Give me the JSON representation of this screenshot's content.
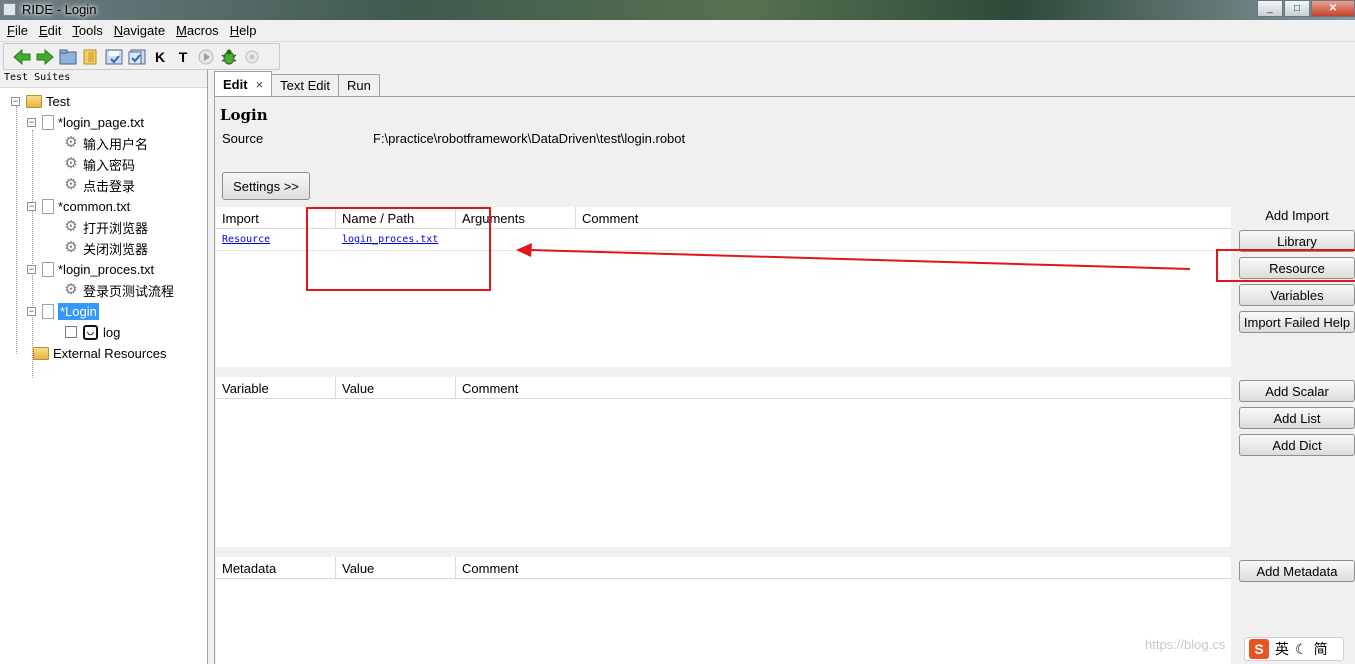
{
  "window": {
    "title": "RIDE - Login",
    "minimize": "_",
    "maximize": "□",
    "close": "✕"
  },
  "menu": [
    {
      "key": "F",
      "rest": "ile"
    },
    {
      "key": "E",
      "rest": "dit"
    },
    {
      "key": "T",
      "rest": "ools"
    },
    {
      "key": "N",
      "rest": "avigate"
    },
    {
      "key": "M",
      "rest": "acros"
    },
    {
      "key": "H",
      "rest": "elp"
    }
  ],
  "toolbar": {
    "icons": [
      "back-icon",
      "forward-icon",
      "open-folder-icon",
      "open-directory-icon",
      "save-icon",
      "save-all-icon",
      "search-keywords-icon",
      "search-tests-icon",
      "run-icon",
      "debug-bug-icon",
      "stop-icon"
    ],
    "k_label": "K",
    "t_label": "T"
  },
  "tree": {
    "header": "Test Suites",
    "nodes": {
      "test": "Test",
      "login_page": "*login_page.txt",
      "kw_input_user": "输入用户名",
      "kw_input_pwd": "输入密码",
      "kw_click_login": "点击登录",
      "common": "*common.txt",
      "kw_open_browser": "打开浏览器",
      "kw_close_browser": "关闭浏览器",
      "login_proces": "*login_proces.txt",
      "kw_login_flow": "登录页测试流程",
      "login": "*Login",
      "log": "log",
      "external": "External Resources"
    }
  },
  "tabs": {
    "edit": "Edit",
    "edit_close": "×",
    "text_edit": "Text Edit",
    "run": "Run"
  },
  "editor": {
    "title": "Login",
    "source_label": "Source",
    "source_value": "F:\\practice\\robotframework\\DataDriven\\test\\login.robot",
    "settings_button": "Settings >>"
  },
  "imports": {
    "headers": [
      "Import",
      "Name / Path",
      "Arguments",
      "Comment"
    ],
    "rows": [
      {
        "type": "Resource",
        "path": "login_proces.txt"
      }
    ]
  },
  "variables": {
    "headers": [
      "Variable",
      "Value",
      "Comment"
    ]
  },
  "metadata": {
    "headers": [
      "Metadata",
      "Value",
      "Comment"
    ]
  },
  "side": {
    "add_import_label": "Add Import",
    "library": "Library",
    "resource": "Resource",
    "variables": "Variables",
    "import_failed_help": "Import Failed Help",
    "add_scalar": "Add Scalar",
    "add_list": "Add List",
    "add_dict": "Add Dict",
    "add_metadata": "Add Metadata"
  },
  "overlay": {
    "watermark": "https://blog.cs",
    "ime_logo": "S",
    "ime_lang": "英",
    "ime_mode": "简"
  },
  "colors": {
    "annotation": "#e0161b",
    "selection": "#3399ff",
    "link": "#0000ee"
  }
}
